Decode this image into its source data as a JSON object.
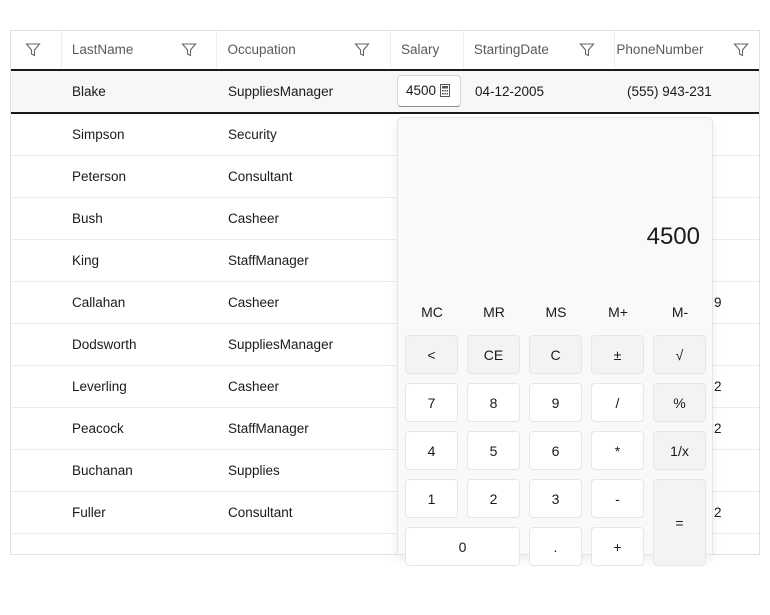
{
  "columns": [
    {
      "label": "",
      "filter": true
    },
    {
      "label": "LastName",
      "filter": true
    },
    {
      "label": "Occupation",
      "filter": true
    },
    {
      "label": "Salary",
      "filter": false
    },
    {
      "label": "StartingDate",
      "filter": true
    },
    {
      "label": "PhoneNumber",
      "filter": true
    }
  ],
  "selected_row": {
    "last_name": "Blake",
    "occupation": "SuppliesManager",
    "salary": "4500",
    "starting_date": "04-12-2005",
    "phone": "(555) 943-231"
  },
  "rows": [
    {
      "last_name": "Simpson",
      "occupation": "Security",
      "phone_tail": ""
    },
    {
      "last_name": "Peterson",
      "occupation": "Consultant",
      "phone_tail": ""
    },
    {
      "last_name": "Bush",
      "occupation": "Casheer",
      "phone_tail": ""
    },
    {
      "last_name": "King",
      "occupation": "StaffManager",
      "phone_tail": ""
    },
    {
      "last_name": "Callahan",
      "occupation": "Casheer",
      "phone_tail": "9"
    },
    {
      "last_name": "Dodsworth",
      "occupation": "SuppliesManager",
      "phone_tail": ""
    },
    {
      "last_name": "Leverling",
      "occupation": "Casheer",
      "phone_tail": "2"
    },
    {
      "last_name": "Peacock",
      "occupation": "StaffManager",
      "phone_tail": "2"
    },
    {
      "last_name": "Buchanan",
      "occupation": "Supplies",
      "phone_tail": ""
    },
    {
      "last_name": "Fuller",
      "occupation": "Consultant",
      "phone_tail": "2"
    }
  ],
  "calculator": {
    "display": "4500",
    "memory": [
      "MC",
      "MR",
      "MS",
      "M+",
      "M-"
    ],
    "keys": [
      [
        "<",
        "CE",
        "C",
        "±",
        "√"
      ],
      [
        "7",
        "8",
        "9",
        "/",
        "%"
      ],
      [
        "4",
        "5",
        "6",
        "*",
        "1/x"
      ],
      [
        "1",
        "2",
        "3",
        "-",
        "="
      ],
      [
        "0",
        ".",
        "+"
      ]
    ]
  }
}
